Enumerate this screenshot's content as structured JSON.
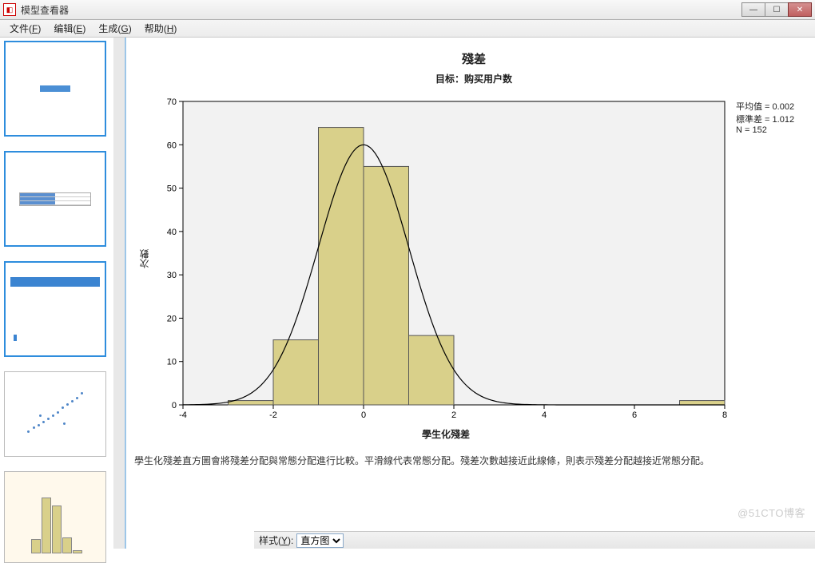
{
  "window": {
    "title": "模型查看器"
  },
  "menu": {
    "file": "文件(",
    "file_accel": "F",
    "file_tail": ")",
    "edit": "编辑(",
    "edit_accel": "E",
    "edit_tail": ")",
    "generate": "生成(",
    "generate_accel": "G",
    "generate_tail": ")",
    "help": "帮助(",
    "help_accel": "H",
    "help_tail": ")"
  },
  "chart": {
    "title": "殘差",
    "subtitle": "目标：购买用户数",
    "ylabel": "次數",
    "xlabel": "學生化殘差",
    "stats_mean_label": "平均值 = ",
    "stats_mean": "0.002",
    "stats_sd_label": "標準差 = ",
    "stats_sd": "1.012",
    "stats_n_label": "N = ",
    "stats_n": "152"
  },
  "caption": "學生化殘差直方圖會將殘差分配與常態分配進行比較。平滑線代表常態分配。殘差次數越接近此線條，則表示殘差分配越接近常態分配。",
  "stylebar": {
    "label_pre": "样式(",
    "label_accel": "Y",
    "label_tail": "):",
    "option": "直方图"
  },
  "watermark": "@51CTO博客",
  "chart_data": {
    "type": "bar",
    "title": "殘差",
    "subtitle": "目标：购买用户数",
    "xlabel": "學生化殘差",
    "ylabel": "次數",
    "xlim": [
      -4,
      8
    ],
    "ylim": [
      0,
      70
    ],
    "xticks": [
      -4,
      -2,
      0,
      2,
      4,
      6,
      8
    ],
    "yticks": [
      0,
      10,
      20,
      30,
      40,
      50,
      60,
      70
    ],
    "bin_edges": [
      -3,
      -2,
      -1,
      0,
      1,
      2,
      3,
      7,
      8
    ],
    "counts": [
      1,
      15,
      64,
      55,
      16,
      0,
      0,
      1
    ],
    "overlay": {
      "type": "normal_curve",
      "peak_x": 0,
      "peak_y": 60
    },
    "annotations": {
      "mean": 0.002,
      "std": 1.012,
      "N": 152
    }
  }
}
